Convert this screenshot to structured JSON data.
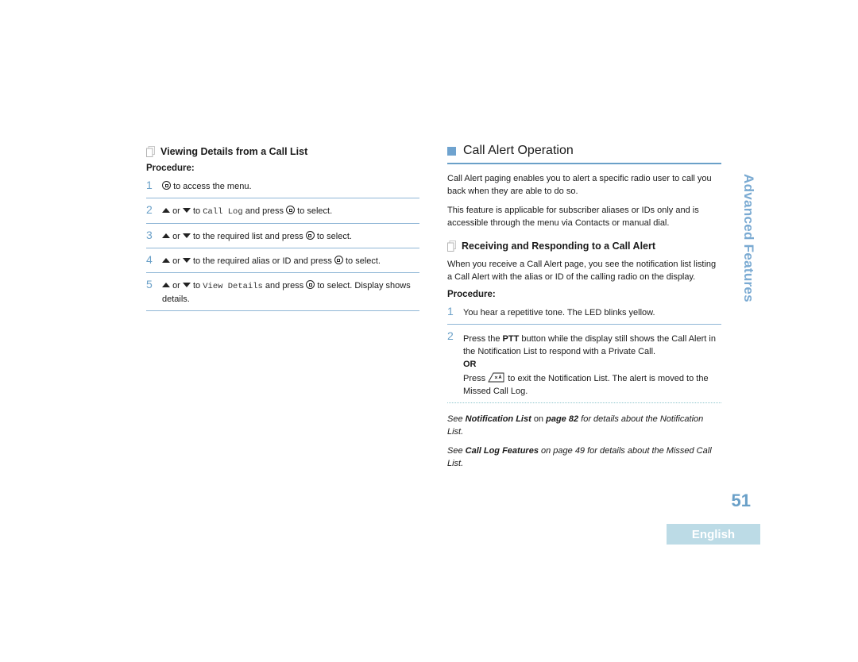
{
  "left": {
    "subheading": "Viewing Details from a Call List",
    "procedure_label": "Procedure:",
    "steps": [
      {
        "num": "1",
        "text_a": "to access the menu."
      },
      {
        "num": "2",
        "or": "or",
        "to": "to",
        "mono": "Call Log",
        "mid": "and press",
        "end": "to select."
      },
      {
        "num": "3",
        "or": "or",
        "to": "to the required list and press",
        "end": "to select."
      },
      {
        "num": "4",
        "or": "or",
        "to": "to the required alias or ID and press",
        "end": "to select."
      },
      {
        "num": "5",
        "or": "or",
        "to": "to",
        "mono": "View Details",
        "mid": "and press",
        "end": "to select. Display shows details."
      }
    ]
  },
  "right": {
    "section_title": "Call Alert Operation",
    "intro_1": "Call Alert paging enables you to alert a specific radio user to call you back when they are able to do so.",
    "intro_2": "This feature is applicable for subscriber aliases or IDs only and is accessible through the menu via Contacts or manual dial.",
    "subheading": "Receiving and Responding to a Call Alert",
    "sub_intro": "When you receive a Call Alert page, you see the notification list listing a Call Alert with the alias or ID of the calling radio on the display.",
    "procedure_label": "Procedure:",
    "step1": {
      "num": "1",
      "text": "You hear a repetitive tone. The LED blinks yellow."
    },
    "step2": {
      "num": "2",
      "pre": "Press the",
      "bold": "PTT",
      "post": "button while the display still shows the Call Alert in the Notification List to respond with a Private Call.",
      "or_label": "OR",
      "alt_pre": "Press",
      "alt_post": "to exit the Notification List. The alert is moved to the Missed Call Log."
    },
    "ref1": {
      "see": "See",
      "link": "Notification List",
      "on": "on",
      "page": "page 82",
      "rest": "for details about the Notification List."
    },
    "ref2": {
      "see": "See",
      "link": "Call Log Features",
      "rest": "on page 49 for details about the Missed Call List."
    }
  },
  "side_tab": "Advanced Features",
  "page_number": "51",
  "language_tab": "English",
  "icons": {
    "menu_ok": "menu-ok-button-icon",
    "up": "up-arrow-icon",
    "down": "down-arrow-icon",
    "end_key": "end-call-key-icon",
    "subsection": "page-stack-icon",
    "section": "blue-square-icon"
  },
  "colors": {
    "accent": "#6aa0c8",
    "rule": "#8fb6d6",
    "language_tab_bg": "#bcdbe6"
  }
}
